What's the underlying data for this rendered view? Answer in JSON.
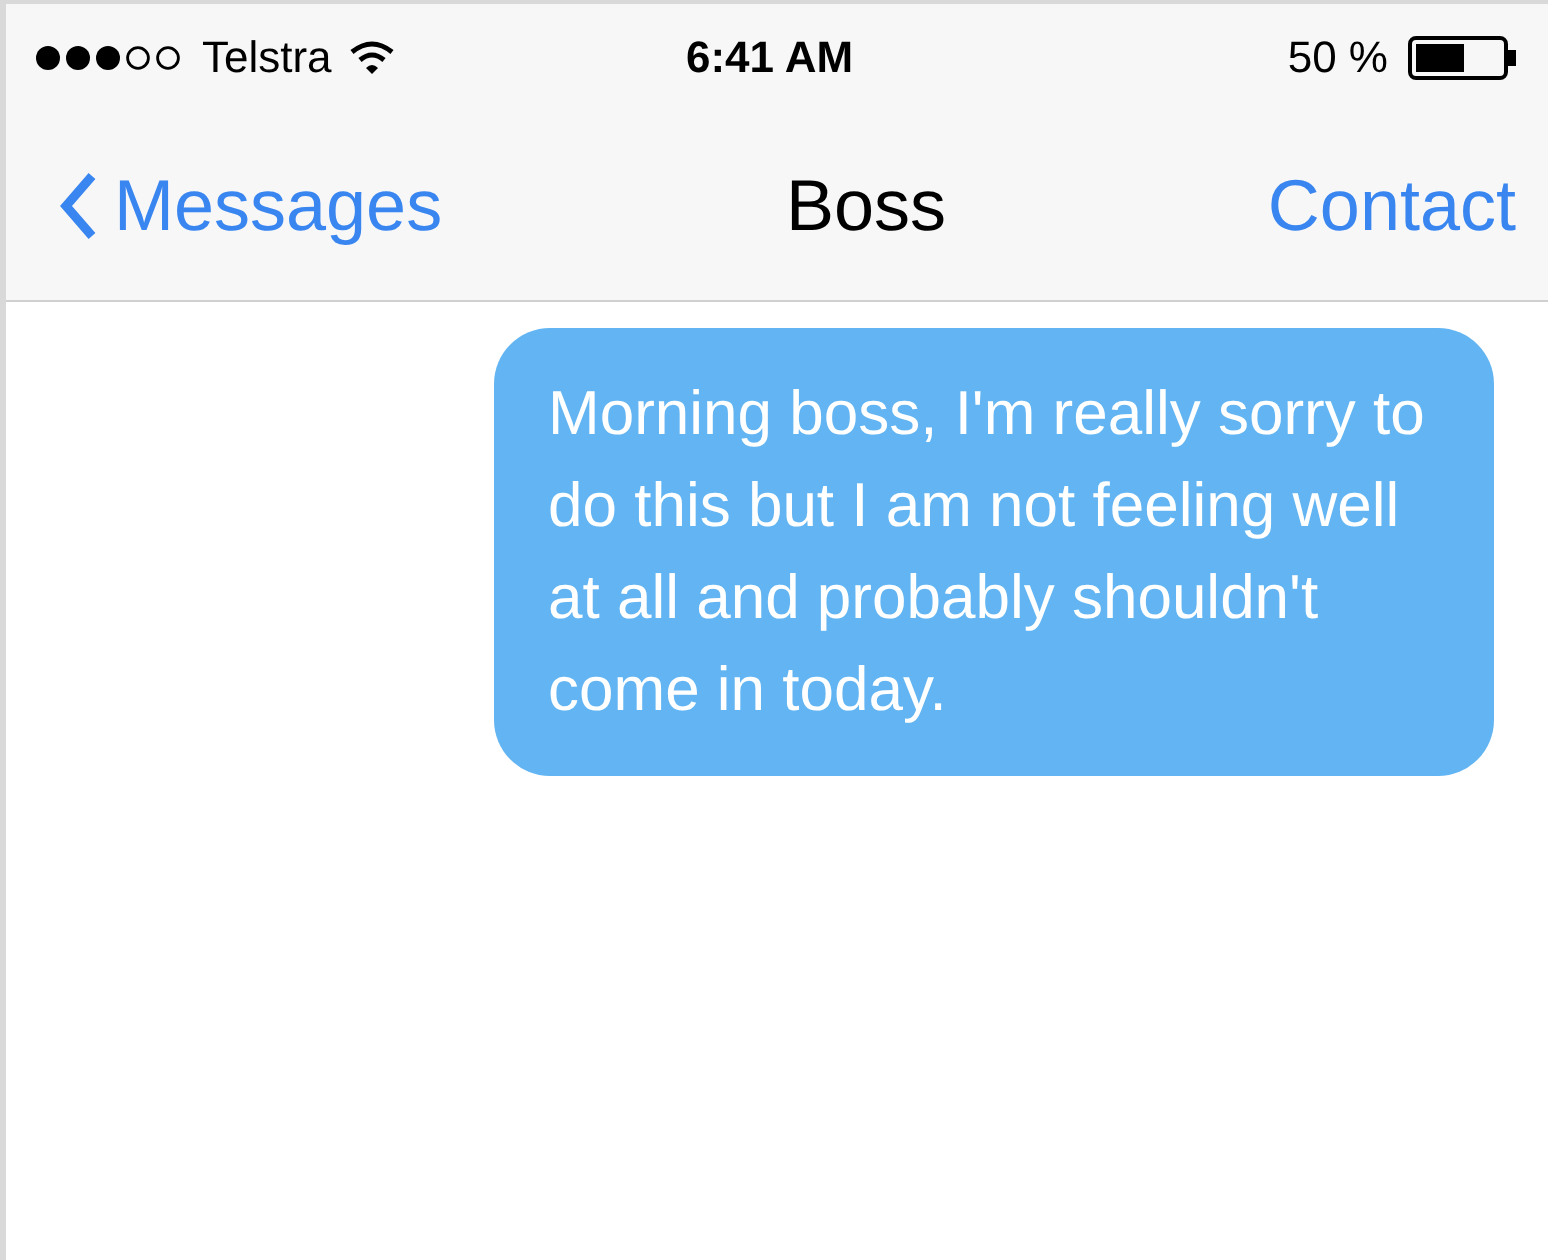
{
  "status_bar": {
    "carrier": "Telstra",
    "time": "6:41 AM",
    "battery": "50 %"
  },
  "nav_bar": {
    "back": "Messages",
    "title": "Boss",
    "action": "Contact"
  },
  "messages": [
    {
      "text": "Morning boss, I'm really sorry to do this but I am not feeling well at all and probably shouldn't come in today.",
      "outgoing": true
    }
  ]
}
